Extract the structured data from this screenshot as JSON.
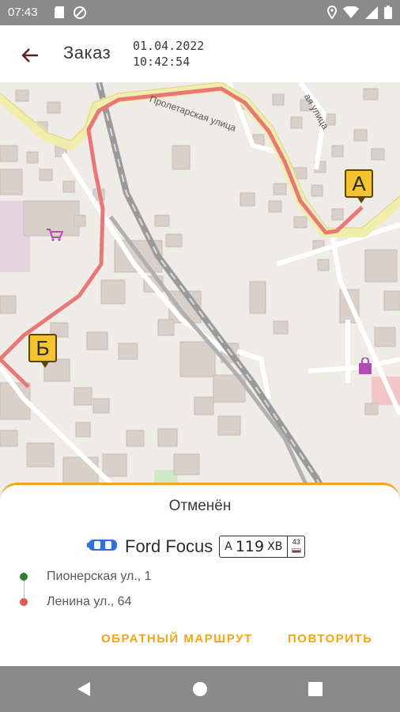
{
  "statusbar": {
    "time": "07:43",
    "icons_left": [
      "sd-card-icon",
      "notification-blocked-icon"
    ],
    "icons_right": [
      "location-icon",
      "wifi-icon",
      "signal-icon",
      "battery-icon"
    ]
  },
  "appbar": {
    "title": "Заказ",
    "date": "01.04.2022",
    "time": "10:42:54"
  },
  "map": {
    "street_proletarskaya": "Пролетарская улица",
    "street_partial": "ая улица",
    "marker_a": "А",
    "marker_b": "Б",
    "route_color": "#e87878"
  },
  "order": {
    "status": "Отменён",
    "car_name": "Ford Focus",
    "car_icon": "car-icon",
    "car_color": "#2f6fe0",
    "plate": {
      "letter1": "А",
      "number": "119",
      "letters2": "ХВ",
      "region": "43"
    },
    "from_address": "Пионерская ул., 1",
    "to_address": "Ленина ул., 64",
    "from_color": "#2e7d32",
    "to_color": "#e05a5a"
  },
  "actions": {
    "reverse_route": "ОБРАТНЫЙ МАРШРУТ",
    "repeat": "ПОВТОРИТЬ",
    "accent": "#f2a516"
  }
}
